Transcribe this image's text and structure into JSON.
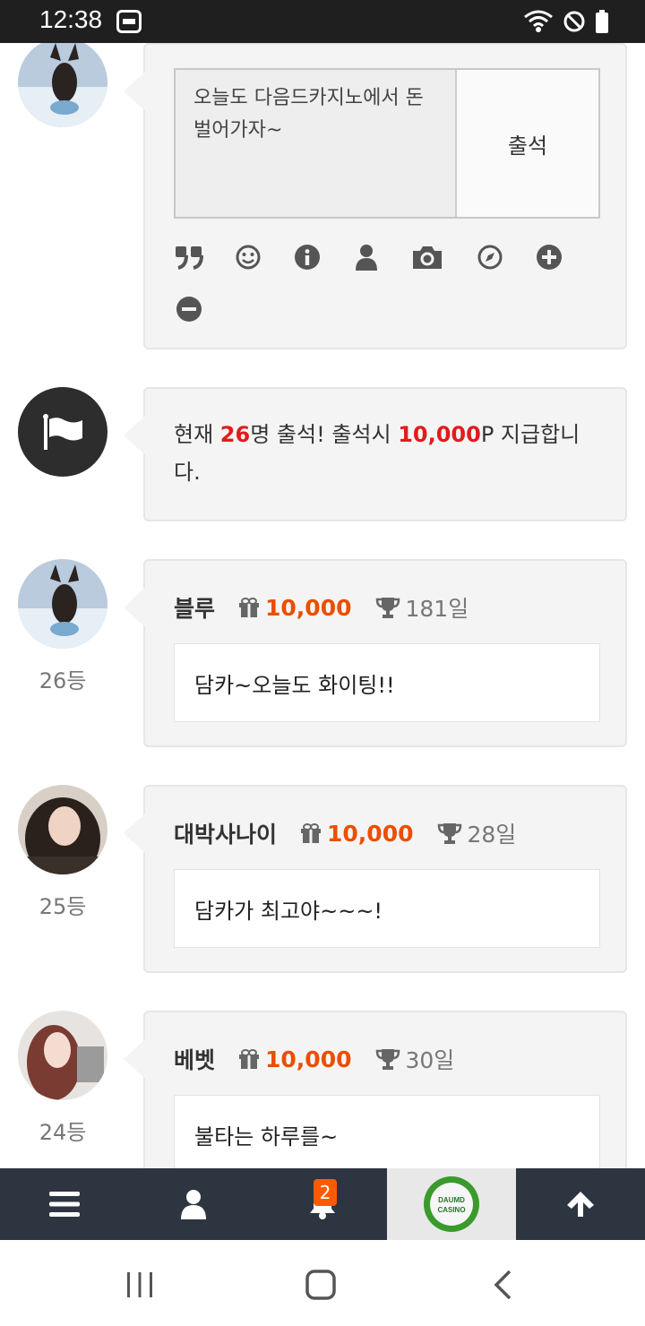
{
  "status_bar": {
    "time": "12:38",
    "icons": [
      "app-notification-icon",
      "wifi-icon",
      "do-not-disturb-icon",
      "battery-icon"
    ]
  },
  "composer": {
    "text": "오늘도 다음드카지노에서 돈 벌어가자~",
    "submit_label": "출석",
    "tools": [
      "quote-icon",
      "smile-icon",
      "info-icon",
      "user-icon",
      "camera-icon",
      "compass-icon",
      "plus-circle-icon",
      "minus-circle-icon"
    ]
  },
  "notice": {
    "prefix": "현재 ",
    "count": "26",
    "middle": "명 출석! 출석시 ",
    "points": "10,000",
    "suffix": "P 지급합니다."
  },
  "entries": [
    {
      "rank": "26등",
      "name": "블루",
      "points": "10,000",
      "days": "181일",
      "message": "담카~오늘도 화이팅!!"
    },
    {
      "rank": "25등",
      "name": "대박사나이",
      "points": "10,000",
      "days": "28일",
      "message": "담카가 최고야~~~!"
    },
    {
      "rank": "24등",
      "name": "베벳",
      "points": "10,000",
      "days": "30일",
      "message": "불타는 하루를~"
    }
  ],
  "bottom_nav": {
    "items": [
      "menu-icon",
      "user-icon",
      "bell-icon",
      "logo",
      "arrow-up-icon"
    ],
    "notification_count": "2",
    "logo_text_1": "DAUMD",
    "logo_text_2": "CASINO"
  },
  "colors": {
    "accent_red": "#e21b1b",
    "points_orange": "#ea4e00",
    "nav_bg": "#2d3540",
    "badge": "#ff5a00"
  }
}
